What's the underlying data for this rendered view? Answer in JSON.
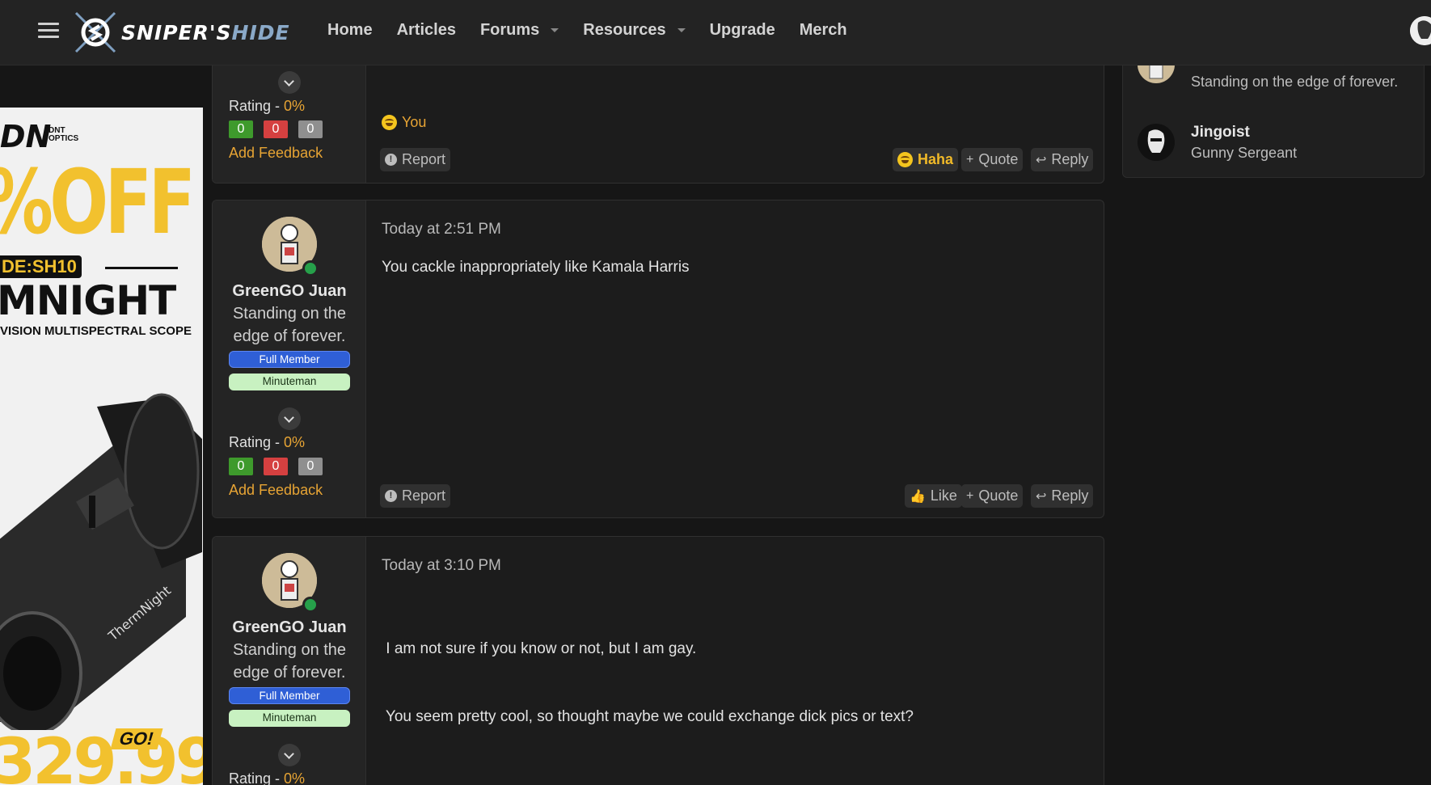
{
  "header": {
    "logo_text_a": "SNIPER'S",
    "logo_text_b": "HIDE",
    "nav": [
      {
        "label": "Home",
        "dropdown": false
      },
      {
        "label": "Articles",
        "dropdown": false
      },
      {
        "label": "Forums",
        "dropdown": true
      },
      {
        "label": "Resources",
        "dropdown": true
      },
      {
        "label": "Upgrade",
        "dropdown": false
      },
      {
        "label": "Merch",
        "dropdown": false
      }
    ]
  },
  "ad": {
    "brand": "DN",
    "brand_sub_1": "DNT",
    "brand_sub_2": "OPTICS",
    "discount": "%OFF",
    "code": "DE:SH10",
    "product": "MNIGHT",
    "tagline": "VISION MULTISPECTRAL SCOPE",
    "price": "329.99",
    "go": "GO!"
  },
  "posts": [
    {
      "rating_label": "Rating - ",
      "rating_pct": "0%",
      "votes": {
        "positive": "0",
        "negative": "0",
        "neutral": "0"
      },
      "feedback": "Add Feedback",
      "reaction_you": "You",
      "actions": {
        "report": "Report",
        "react": "Haha",
        "quote": "Quote",
        "reply": "Reply"
      }
    },
    {
      "username": "GreenGO Juan",
      "user_title_1": "Standing on the",
      "user_title_2": "edge of forever.",
      "badge_1": "Full Member",
      "badge_2": "Minuteman",
      "rating_label": "Rating - ",
      "rating_pct": "0%",
      "votes": {
        "positive": "0",
        "negative": "0",
        "neutral": "0"
      },
      "feedback": "Add Feedback",
      "date": "Today at 2:51 PM",
      "message_lines": [
        "You cackle inappropriately like Kamala Harris"
      ],
      "actions": {
        "report": "Report",
        "react": "Like",
        "quote": "Quote",
        "reply": "Reply"
      }
    },
    {
      "username": "GreenGO Juan",
      "user_title_1": "Standing on the",
      "user_title_2": "edge of forever.",
      "badge_1": "Full Member",
      "badge_2": "Minuteman",
      "rating_label": "Rating - ",
      "rating_pct": "0%",
      "date": "Today at 3:10 PM",
      "message_lines": [
        " I am not sure if you know or not, but I am gay.",
        " You seem pretty cool, so thought maybe we could exchange dick pics or text?"
      ]
    }
  ],
  "sidebar": {
    "members": [
      {
        "name": "",
        "title": "Standing on the edge of forever."
      },
      {
        "name": "Jingoist",
        "title": "Gunny Sergeant"
      }
    ]
  },
  "colors": {
    "accent": "#e7a434",
    "badge_full": "#2f5fd6",
    "badge_minute": "#c8f1c1",
    "positive": "#3e9a2c",
    "negative": "#d54040"
  }
}
